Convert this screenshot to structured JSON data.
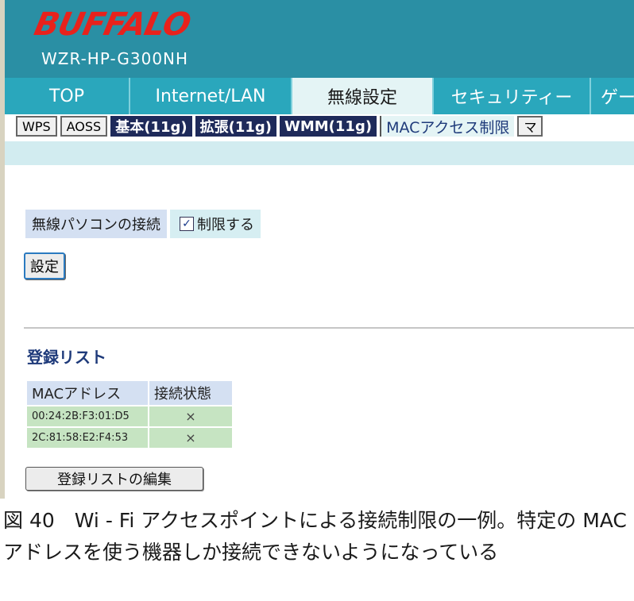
{
  "header": {
    "logo": "BUFFALO",
    "model": "WZR-HP-G300NH"
  },
  "tabs": [
    "TOP",
    "Internet/LAN",
    "無線設定",
    "セキュリティー",
    "ゲー"
  ],
  "subnav": [
    "WPS",
    "AOSS",
    "基本(11g)",
    "拡張(11g)",
    "WMM(11g)",
    "MACアクセス制限",
    "マ"
  ],
  "setting": {
    "label": "無線パソコンの接続",
    "checkbox_label": "制限する",
    "checked": true,
    "submit": "設定"
  },
  "registered_list": {
    "title": "登録リスト",
    "columns": [
      "MACアドレス",
      "接続状態"
    ],
    "rows": [
      {
        "mac": "00:24:2B:F3:01:D5",
        "status": "×"
      },
      {
        "mac": "2C:81:58:E2:F4:53",
        "status": "×"
      }
    ],
    "edit_button": "登録リストの編集"
  },
  "caption": "図 40　Wi - Fi アクセスポイントによる接続制限の一例。特定の MAC アドレスを使う機器しか接続できないようになっている",
  "colors": {
    "header": "#2a8fa4",
    "logo": "#e8221c",
    "tab_active": "#e4f4f5",
    "cell_label": "#d4e0f2",
    "cell_row": "#c6e4c2"
  }
}
